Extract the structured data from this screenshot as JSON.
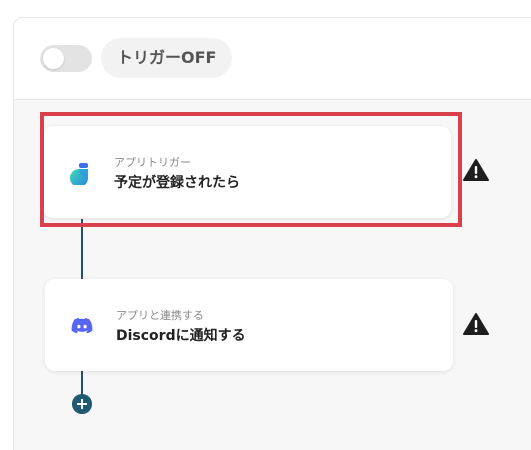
{
  "header": {
    "trigger_status": "トリガーOFF"
  },
  "steps": [
    {
      "subtitle": "アプリトリガー",
      "title": "予定が登録されたら",
      "icon": "calendar-app-icon"
    },
    {
      "subtitle": "アプリと連携する",
      "title": "Discordに通知する",
      "icon": "discord-icon"
    }
  ],
  "colors": {
    "highlight": "#d9404c",
    "connector": "#23506b",
    "discord": "#5865f2"
  }
}
